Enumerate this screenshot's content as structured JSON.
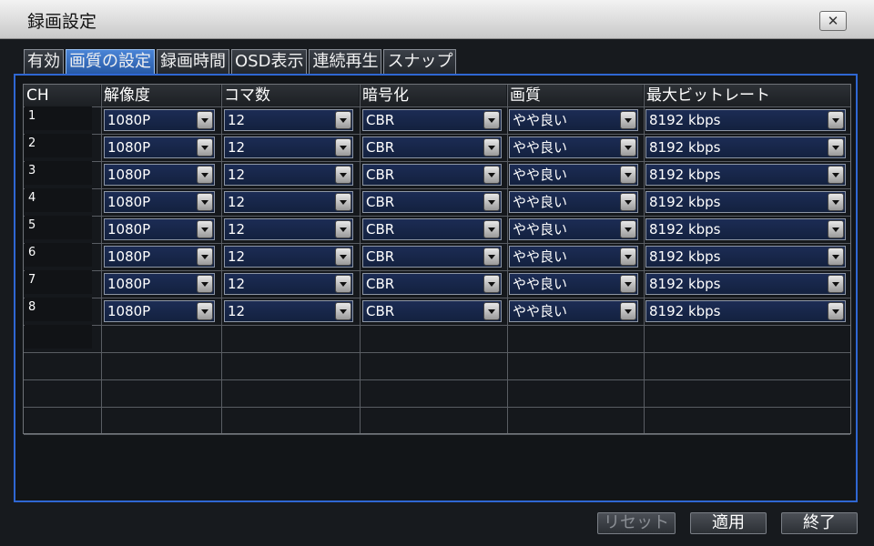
{
  "window": {
    "title": "録画設定",
    "close_symbol": "✕"
  },
  "tabs": [
    {
      "label": "有効",
      "active": false
    },
    {
      "label": "画質の設定",
      "active": true
    },
    {
      "label": "録画時間",
      "active": false
    },
    {
      "label": "OSD表示",
      "active": false
    },
    {
      "label": "連続再生",
      "active": false
    },
    {
      "label": "スナップ",
      "active": false
    }
  ],
  "table": {
    "headers": [
      "CH",
      "解像度",
      "コマ数",
      "暗号化",
      "画質",
      "最大ビットレート"
    ],
    "rows": [
      {
        "ch": "1",
        "resolution": "1080P",
        "fps": "12",
        "encoding": "CBR",
        "quality": "やや良い",
        "bitrate": "8192 kbps"
      },
      {
        "ch": "2",
        "resolution": "1080P",
        "fps": "12",
        "encoding": "CBR",
        "quality": "やや良い",
        "bitrate": "8192 kbps"
      },
      {
        "ch": "3",
        "resolution": "1080P",
        "fps": "12",
        "encoding": "CBR",
        "quality": "やや良い",
        "bitrate": "8192 kbps"
      },
      {
        "ch": "4",
        "resolution": "1080P",
        "fps": "12",
        "encoding": "CBR",
        "quality": "やや良い",
        "bitrate": "8192 kbps"
      },
      {
        "ch": "5",
        "resolution": "1080P",
        "fps": "12",
        "encoding": "CBR",
        "quality": "やや良い",
        "bitrate": "8192 kbps"
      },
      {
        "ch": "6",
        "resolution": "1080P",
        "fps": "12",
        "encoding": "CBR",
        "quality": "やや良い",
        "bitrate": "8192 kbps"
      },
      {
        "ch": "7",
        "resolution": "1080P",
        "fps": "12",
        "encoding": "CBR",
        "quality": "やや良い",
        "bitrate": "8192 kbps"
      },
      {
        "ch": "8",
        "resolution": "1080P",
        "fps": "12",
        "encoding": "CBR",
        "quality": "やや良い",
        "bitrate": "8192 kbps"
      }
    ]
  },
  "footer": {
    "reset": "リセット",
    "apply": "適用",
    "exit": "終了"
  },
  "colors": {
    "accent": "#2f67d3",
    "active_tab": "#3a72c4",
    "dropdown_bg": "#172546"
  }
}
